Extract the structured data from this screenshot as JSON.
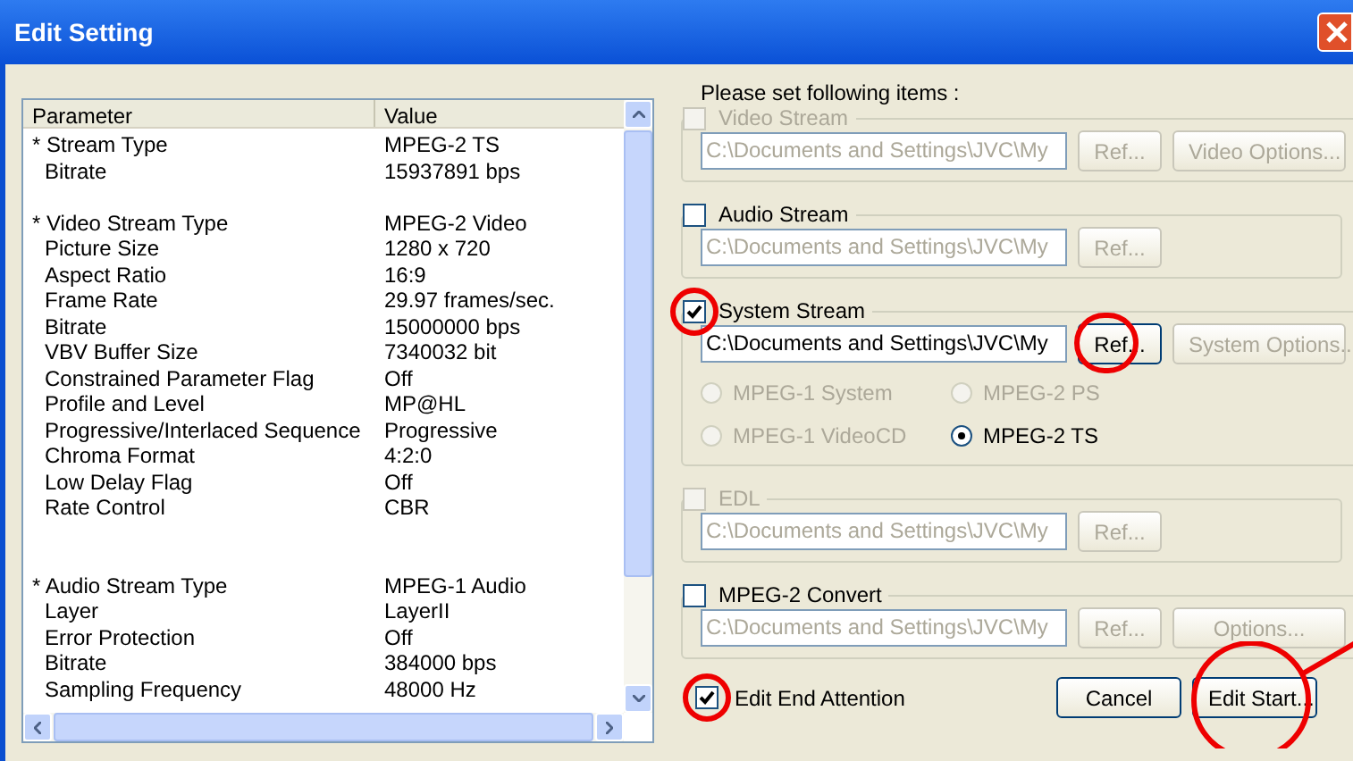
{
  "window": {
    "title": "Edit Setting"
  },
  "table": {
    "columns": [
      "Parameter",
      "Value"
    ],
    "rows": [
      {
        "kind": "head",
        "parameter": "* Stream Type",
        "value": "MPEG-2 TS"
      },
      {
        "kind": "item",
        "parameter": "Bitrate",
        "value": "15937891 bps"
      },
      {
        "kind": "blank"
      },
      {
        "kind": "head",
        "parameter": "* Video Stream Type",
        "value": "MPEG-2 Video"
      },
      {
        "kind": "item",
        "parameter": "Picture Size",
        "value": "1280 x 720"
      },
      {
        "kind": "item",
        "parameter": "Aspect Ratio",
        "value": "16:9"
      },
      {
        "kind": "item",
        "parameter": "Frame Rate",
        "value": "29.97 frames/sec."
      },
      {
        "kind": "item",
        "parameter": "Bitrate",
        "value": "15000000 bps"
      },
      {
        "kind": "item",
        "parameter": "VBV Buffer Size",
        "value": "7340032 bit"
      },
      {
        "kind": "item",
        "parameter": "Constrained Parameter Flag",
        "value": "Off"
      },
      {
        "kind": "item",
        "parameter": "Profile and Level",
        "value": "MP@HL"
      },
      {
        "kind": "item",
        "parameter": "Progressive/Interlaced Sequence",
        "value": "Progressive"
      },
      {
        "kind": "item",
        "parameter": "Chroma Format",
        "value": "4:2:0"
      },
      {
        "kind": "item",
        "parameter": "Low Delay Flag",
        "value": "Off"
      },
      {
        "kind": "item",
        "parameter": "Rate Control",
        "value": "CBR"
      },
      {
        "kind": "blank"
      },
      {
        "kind": "blank"
      },
      {
        "kind": "head",
        "parameter": "* Audio Stream Type",
        "value": "MPEG-1 Audio"
      },
      {
        "kind": "item",
        "parameter": "Layer",
        "value": "LayerII"
      },
      {
        "kind": "item",
        "parameter": "Error Protection",
        "value": "Off"
      },
      {
        "kind": "item",
        "parameter": "Bitrate",
        "value": "384000 bps"
      },
      {
        "kind": "item",
        "parameter": "Sampling Frequency",
        "value": "48000 Hz"
      }
    ]
  },
  "instruction": "Please set following items :",
  "groups": [
    {
      "label": "Video Stream",
      "checked": false,
      "disabled": true,
      "path": "C:\\Documents and Settings\\JVC\\My",
      "path_disabled": true,
      "ref": {
        "label": "Ref...",
        "disabled": true
      },
      "options": {
        "label": "Video Options...",
        "disabled": true
      }
    },
    {
      "label": "Audio Stream",
      "checked": false,
      "disabled": false,
      "path": "C:\\Documents and Settings\\JVC\\My",
      "path_disabled": true,
      "ref": {
        "label": "Ref...",
        "disabled": true
      }
    },
    {
      "label": "System Stream",
      "checked": true,
      "disabled": false,
      "path": "C:\\Documents and Settings\\JVC\\My",
      "path_disabled": false,
      "ref": {
        "label": "Ref...",
        "disabled": false
      },
      "options": {
        "label": "System Options...",
        "disabled": true
      },
      "radios": [
        {
          "label": "MPEG-1 System",
          "selected": false,
          "disabled": true
        },
        {
          "label": "MPEG-2 PS",
          "selected": false,
          "disabled": true
        },
        {
          "label": "MPEG-1 VideoCD",
          "selected": false,
          "disabled": true
        },
        {
          "label": "MPEG-2 TS",
          "selected": true,
          "disabled": false
        }
      ]
    },
    {
      "label": "EDL",
      "checked": false,
      "disabled": true,
      "path": "C:\\Documents and Settings\\JVC\\My",
      "path_disabled": true,
      "ref": {
        "label": "Ref...",
        "disabled": true
      }
    },
    {
      "label": "MPEG-2 Convert",
      "checked": false,
      "disabled": false,
      "path": "C:\\Documents and Settings\\JVC\\My",
      "path_disabled": true,
      "ref": {
        "label": "Ref...",
        "disabled": true
      },
      "options": {
        "label": "Options...",
        "disabled": true
      }
    }
  ],
  "edit_end_attention": {
    "label": "Edit End Attention",
    "checked": true
  },
  "buttons": [
    "Cancel",
    "Edit Start..."
  ]
}
